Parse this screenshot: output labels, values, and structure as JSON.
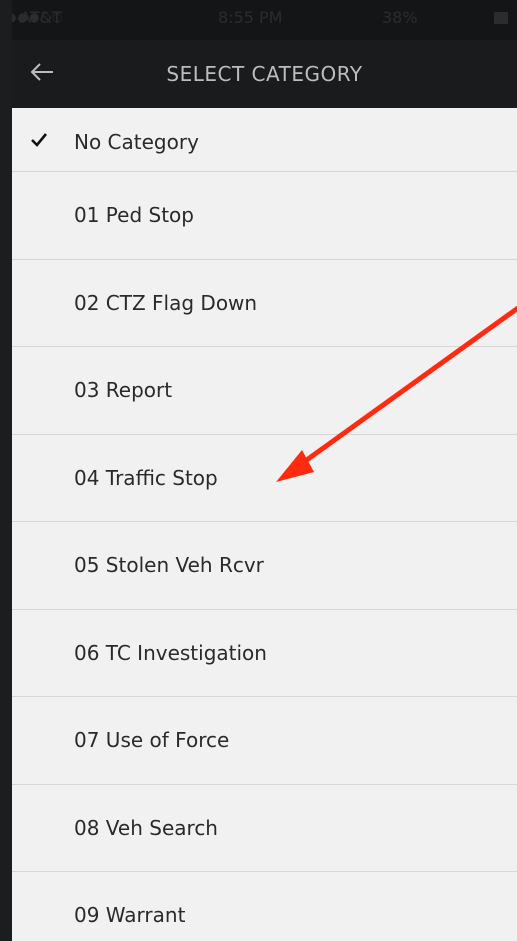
{
  "status_bar": {
    "signal": "●●●○○",
    "carrier": "AT&T",
    "time": "8:55 PM",
    "battery": "38%"
  },
  "header": {
    "title": "SELECT CATEGORY",
    "back_icon": "arrow-left-icon"
  },
  "list": {
    "items": [
      {
        "label": "No Category",
        "selected": true
      },
      {
        "label": "01 Ped Stop",
        "selected": false
      },
      {
        "label": "02 CTZ Flag Down",
        "selected": false
      },
      {
        "label": "03 Report",
        "selected": false
      },
      {
        "label": "04 Traffic Stop",
        "selected": false
      },
      {
        "label": "05 Stolen Veh Rcvr",
        "selected": false
      },
      {
        "label": "06 TC Investigation",
        "selected": false
      },
      {
        "label": "07 Use of Force",
        "selected": false
      },
      {
        "label": "08 Veh Search",
        "selected": false
      },
      {
        "label": "09 Warrant",
        "selected": false
      }
    ]
  },
  "colors": {
    "header_bg": "#1a1b1c",
    "list_bg": "#f1f1f1",
    "annotation": "#ff2a10"
  }
}
